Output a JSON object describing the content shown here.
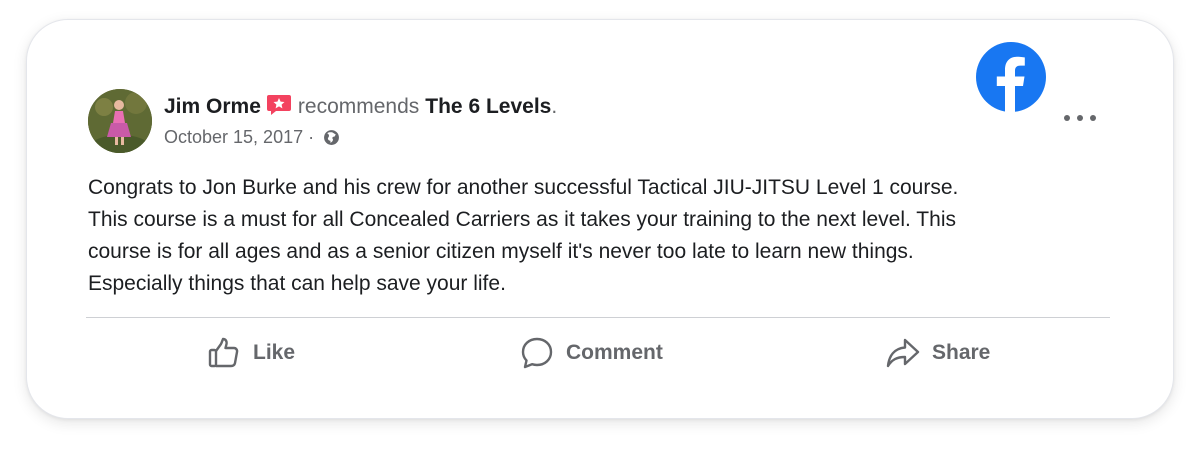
{
  "post": {
    "author": "Jim Orme",
    "action_text": "recommends",
    "page_name": "The 6 Levels",
    "page_name_suffix": ".",
    "date": "October 15, 2017",
    "date_separator": " · ",
    "privacy_icon": "globe-icon",
    "recommend_badge_icon": "recommend-star-icon",
    "body_paragraphs": [
      "Congrats to Jon Burke and his crew for another successful Tactical JIU-JITSU Level 1 course.",
      "This course is a must for all Concealed Carriers as it takes your training to the next level. This",
      "course is for all ages and as a senior citizen myself it's never too late to learn new things.",
      "Especially things that can help save your life."
    ]
  },
  "brand": {
    "logo_icon": "facebook-logo-icon",
    "color": "#1877f2",
    "more_options_icon": "more-options-icon"
  },
  "actions": {
    "like": {
      "label": "Like",
      "icon": "thumbs-up-icon"
    },
    "comment": {
      "label": "Comment",
      "icon": "comment-bubble-icon"
    },
    "share": {
      "label": "Share",
      "icon": "share-arrow-icon"
    }
  },
  "colors": {
    "text_primary": "#1c1e21",
    "text_secondary": "#65676b",
    "recommend_badge": "#f3425f",
    "divider": "#ced0d4"
  }
}
